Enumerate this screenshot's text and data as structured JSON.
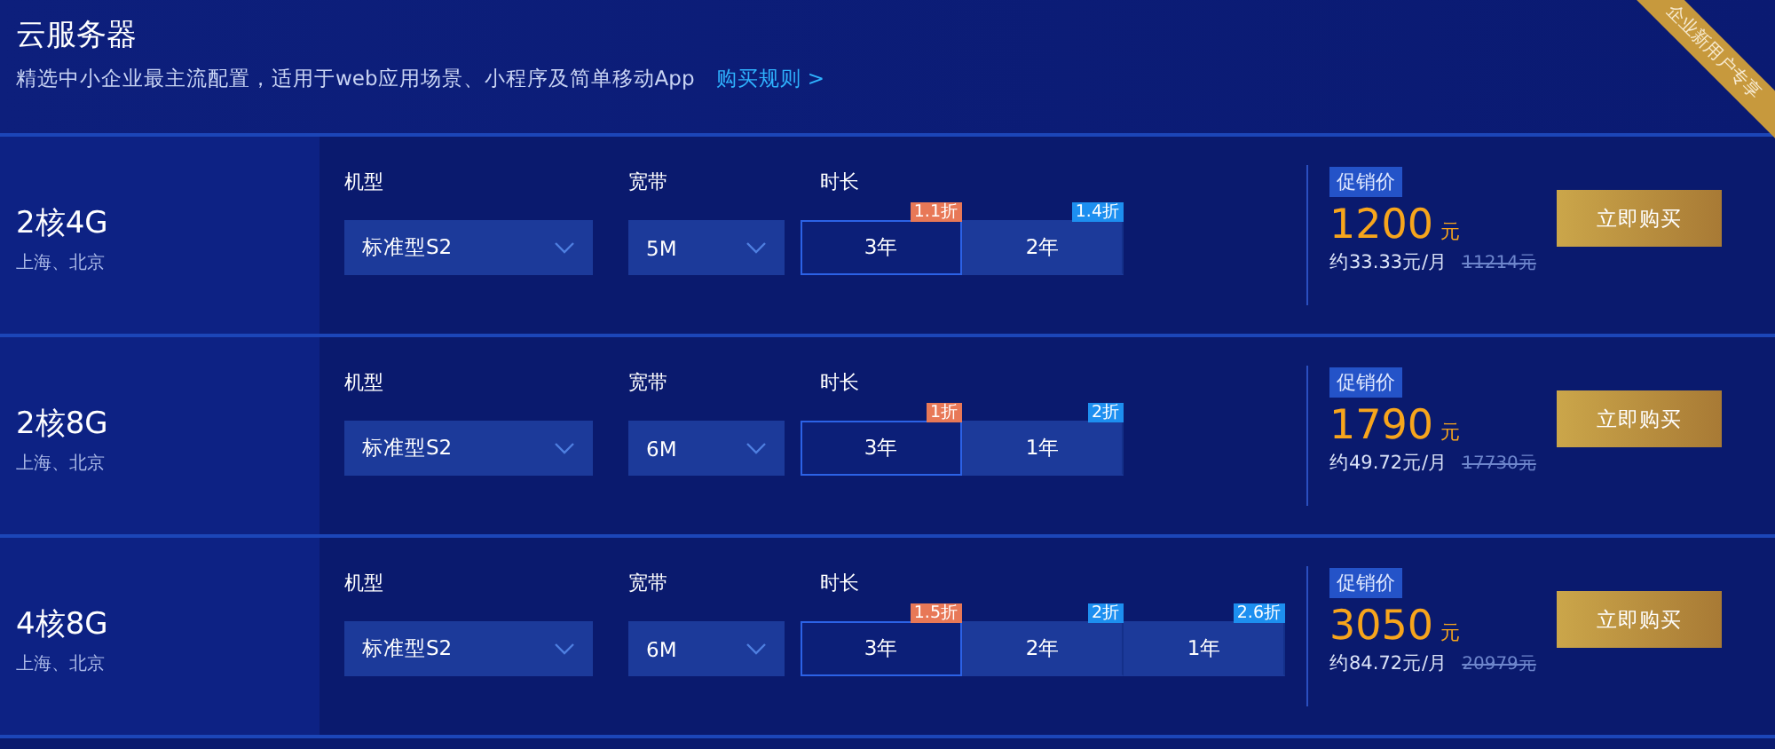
{
  "header": {
    "title": "云服务器",
    "subtitle": "精选中小企业最主流配置，适用于web应用场景、小程序及简单移动App",
    "link": "购买规则 >",
    "ribbon": "企业新用户专享"
  },
  "plans": [
    {
      "name": "2核4G",
      "regions": "上海、北京",
      "model_label": "机型",
      "model": "标准型S2",
      "bandwidth_label": "宽带",
      "bandwidth": "5M",
      "duration_label": "时长",
      "durations": [
        {
          "label": "3年",
          "badge": "1.1折",
          "color": "#e87857",
          "selected": true
        },
        {
          "label": "2年",
          "badge": "1.4折",
          "color": "#1d8ff0",
          "selected": false
        }
      ],
      "promo_label": "促销价",
      "price": "1200",
      "currency": "元",
      "monthly": "约33.33元/月",
      "original_price": "11214元",
      "button": "立即购买"
    },
    {
      "name": "2核8G",
      "regions": "上海、北京",
      "model_label": "机型",
      "model": "标准型S2",
      "bandwidth_label": "宽带",
      "bandwidth": "6M",
      "duration_label": "时长",
      "durations": [
        {
          "label": "3年",
          "badge": "1折",
          "color": "#e87857",
          "selected": true
        },
        {
          "label": "1年",
          "badge": "2折",
          "color": "#1d8ff0",
          "selected": false
        }
      ],
      "promo_label": "促销价",
      "price": "1790",
      "currency": "元",
      "monthly": "约49.72元/月",
      "original_price": "17730元",
      "button": "立即购买"
    },
    {
      "name": "4核8G",
      "regions": "上海、北京",
      "model_label": "机型",
      "model": "标准型S2",
      "bandwidth_label": "宽带",
      "bandwidth": "6M",
      "duration_label": "时长",
      "durations": [
        {
          "label": "3年",
          "badge": "1.5折",
          "color": "#e87857",
          "selected": true
        },
        {
          "label": "2年",
          "badge": "2折",
          "color": "#1d8ff0",
          "selected": false
        },
        {
          "label": "1年",
          "badge": "2.6折",
          "color": "#1d8ff0",
          "selected": false
        }
      ],
      "promo_label": "促销价",
      "price": "3050",
      "currency": "元",
      "monthly": "约84.72元/月",
      "original_price": "20979元",
      "button": "立即购买"
    }
  ]
}
